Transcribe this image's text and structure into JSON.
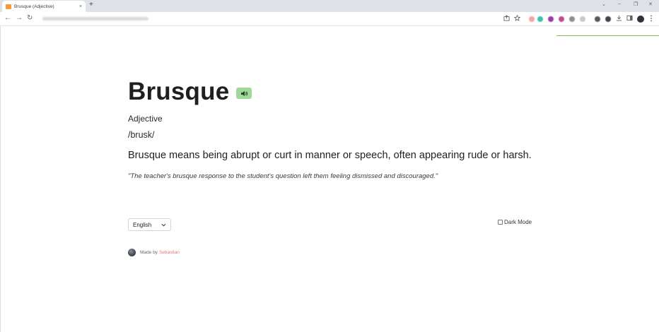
{
  "browser": {
    "tab_title": "Brusque (Adjective)",
    "tab_close": "×",
    "new_tab": "+",
    "win_minimize_chevron": "⌄",
    "win_minimize": "–",
    "win_restore": "❐",
    "win_close": "✕",
    "back": "←",
    "forward": "→",
    "reload": "↻",
    "favicon_color": "#f29b38"
  },
  "entry": {
    "word": "Brusque",
    "part_of_speech": "Adjective",
    "phonetic": "/brusk/",
    "definition": "Brusque means being abrupt or curt in manner or speech, often appearing rude or harsh.",
    "example": "\"The teacher's brusque response to the student's question left them feeling dismissed and discouraged.\""
  },
  "controls": {
    "language_selected": "English",
    "dark_mode_label": "Dark Mode",
    "dark_mode_checked": false
  },
  "footer": {
    "made_by": "Made by",
    "author": "Sebastian"
  },
  "colors": {
    "accent_green": "#9fd89a",
    "author_link": "#e57373",
    "chrome_line": "#8bc34a"
  }
}
